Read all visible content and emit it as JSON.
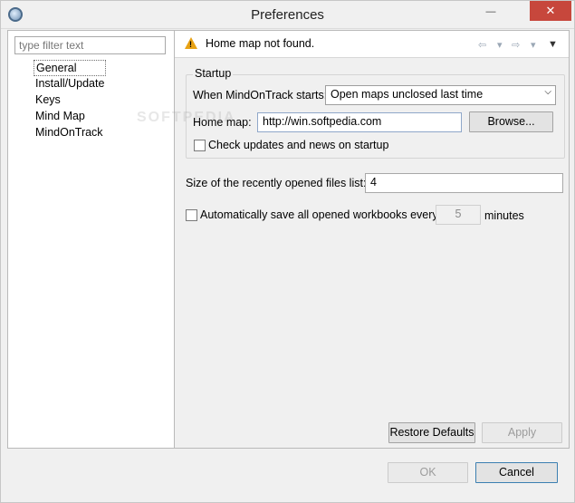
{
  "window": {
    "title": "Preferences",
    "close_glyph": "✕",
    "minimize_glyph": "—"
  },
  "sidebar": {
    "filter_placeholder": "type filter text",
    "items": [
      {
        "label": "General",
        "selected": true
      },
      {
        "label": "Install/Update"
      },
      {
        "label": "Keys"
      },
      {
        "label": "Mind Map"
      },
      {
        "label": "MindOnTrack"
      }
    ]
  },
  "message": {
    "text": "Home map not found.",
    "icon": "warning-icon"
  },
  "nav": {
    "back_glyph": "⇦",
    "forward_glyph": "⇨",
    "dropdown_glyph": "▾",
    "menu_glyph": "▼"
  },
  "startup": {
    "group_label": "Startup",
    "when_starts_label": "When MindOnTrack starts:",
    "when_starts_value": "Open maps unclosed last time",
    "home_map_label": "Home map:",
    "home_map_value": "http://win.softpedia.com",
    "browse_label": "Browse...",
    "check_updates_label": "Check updates and news on startup",
    "check_updates_checked": false
  },
  "recent": {
    "label": "Size of the recently opened files list:",
    "value": "4"
  },
  "autosave": {
    "label": "Automatically save all opened workbooks every",
    "value": "5",
    "unit": "minutes",
    "checked": false
  },
  "buttons": {
    "restore_defaults": "Restore Defaults",
    "apply": "Apply",
    "ok": "OK",
    "cancel": "Cancel"
  },
  "watermark": "SOFTPEDIA"
}
